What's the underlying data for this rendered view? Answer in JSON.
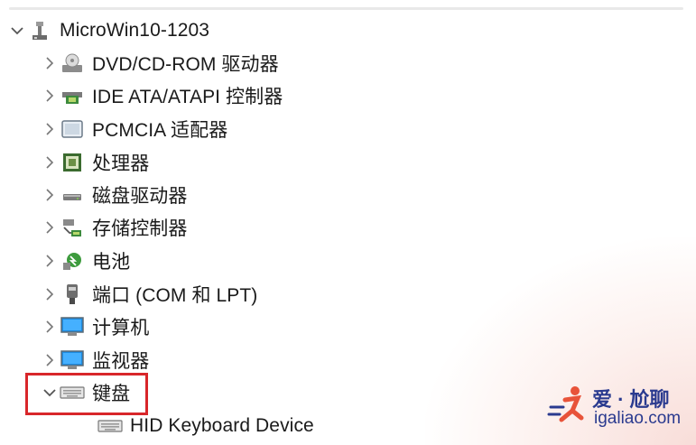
{
  "tree": {
    "root": {
      "label": "MicroWin10-1203",
      "icon": "computer-network-icon"
    },
    "categories": [
      {
        "label": "DVD/CD-ROM 驱动器",
        "icon": "dvd-drive-icon",
        "expanded": false
      },
      {
        "label": "IDE ATA/ATAPI 控制器",
        "icon": "ide-controller-icon",
        "expanded": false
      },
      {
        "label": "PCMCIA 适配器",
        "icon": "pcmcia-adapter-icon",
        "expanded": false
      },
      {
        "label": "处理器",
        "icon": "processor-icon",
        "expanded": false
      },
      {
        "label": "磁盘驱动器",
        "icon": "disk-drive-icon",
        "expanded": false
      },
      {
        "label": "存储控制器",
        "icon": "storage-controller-icon",
        "expanded": false
      },
      {
        "label": "电池",
        "icon": "battery-icon",
        "expanded": false
      },
      {
        "label": "端口 (COM 和 LPT)",
        "icon": "port-icon",
        "expanded": false
      },
      {
        "label": "计算机",
        "icon": "computer-monitor-icon",
        "expanded": false
      },
      {
        "label": "监视器",
        "icon": "monitor-icon",
        "expanded": false
      },
      {
        "label": "键盘",
        "icon": "keyboard-icon",
        "expanded": true
      }
    ],
    "child": {
      "label": "HID Keyboard Device",
      "icon": "keyboard-icon"
    }
  },
  "highlight": {
    "color": "#d8262a",
    "target": "键盘"
  },
  "watermark": {
    "title": "爱 · 尬聊",
    "url": "igaliao.com",
    "color": "#2a3a8f"
  }
}
